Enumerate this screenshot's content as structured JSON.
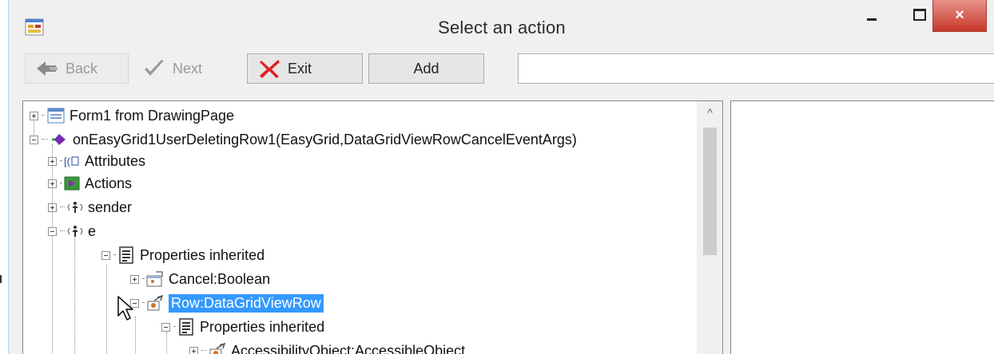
{
  "window": {
    "title": "Select an action",
    "close_symbol": "×",
    "app_icon": "form-window-icon"
  },
  "toolbar": {
    "back_label": "Back",
    "next_label": "Next",
    "exit_label": "Exit",
    "add_label": "Add",
    "search_value": "",
    "back_icon": "back-arrow-icon",
    "next_icon": "checkmark-icon",
    "exit_icon": "red-x-icon"
  },
  "tree": {
    "items": [
      {
        "label": "Form1 from DrawingPage",
        "icon": "form-icon",
        "expander": "plus"
      },
      {
        "label": "onEasyGrid1UserDeletingRow1(EasyGrid,DataGridViewRowCancelEventArgs)",
        "icon": "event-method-icon",
        "expander": "minus"
      },
      {
        "label": "Attributes",
        "icon": "attributes-icon",
        "expander": "plus"
      },
      {
        "label": "Actions",
        "icon": "actions-icon",
        "expander": "plus"
      },
      {
        "label": "sender",
        "icon": "parameter-icon",
        "expander": "plus"
      },
      {
        "label": "e",
        "icon": "parameter-icon",
        "expander": "minus"
      },
      {
        "label": "Properties inherited",
        "icon": "properties-icon",
        "expander": "minus"
      },
      {
        "label": "Cancel:Boolean",
        "icon": "property-icon",
        "expander": "plus"
      },
      {
        "label": "Row:DataGridViewRow",
        "icon": "object-property-icon",
        "expander": "minus",
        "selected": true
      },
      {
        "label": "Properties inherited",
        "icon": "properties-icon",
        "expander": "minus"
      },
      {
        "label": "AccessibilityObject:AccessibleObject",
        "icon": "object-property-icon",
        "expander": "plus"
      }
    ]
  },
  "scrollbar": {
    "up_arrow": "^"
  },
  "colors": {
    "selection": "#3399ff",
    "close_button": "#c7372a",
    "window_bg": "#f0f0f0"
  }
}
